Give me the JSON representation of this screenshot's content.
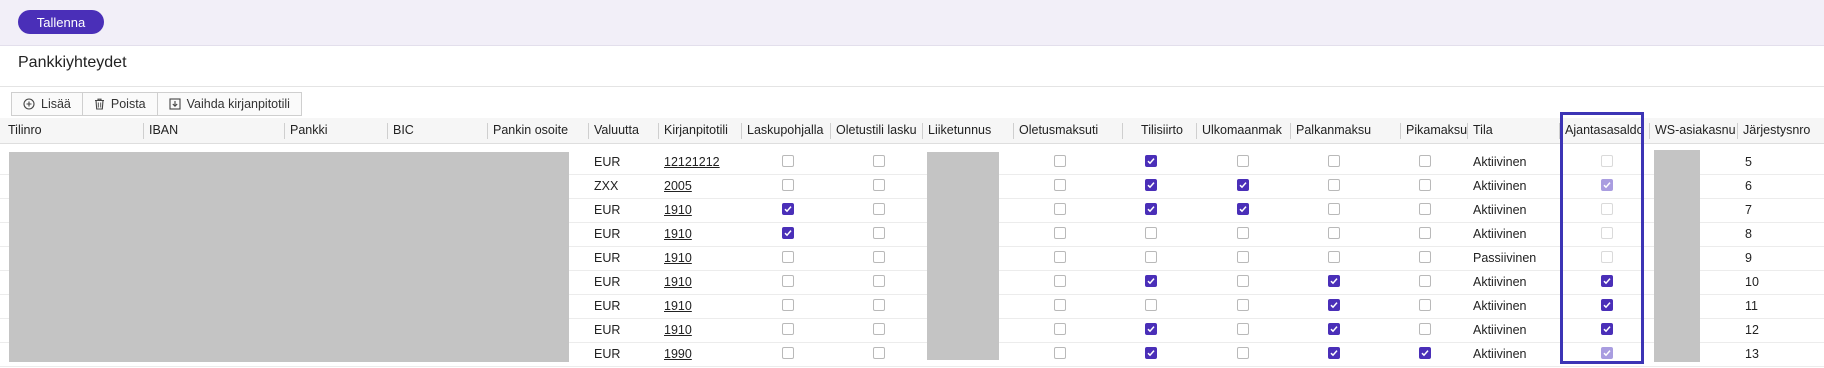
{
  "toolbar_top": {
    "save_label": "Tallenna"
  },
  "page": {
    "title": "Pankkiyhteydet"
  },
  "actions": {
    "add_label": "Lisää",
    "add_icon": "plus-circle-icon",
    "delete_label": "Poista",
    "delete_icon": "trash-icon",
    "switch_label": "Vaihda kirjanpitotili",
    "switch_icon": "download-box-icon"
  },
  "columns": [
    "Tilinro",
    "IBAN",
    "Pankki",
    "BIC",
    "Pankin osoite",
    "Valuutta",
    "Kirjanpitotili",
    "Laskupohjalla",
    "Oletustili lasku",
    "Liiketunnus",
    "Oletusmaksuti",
    "Tilisiirto",
    "Ulkomaanmak",
    "Palkanmaksu",
    "Pikamaksu",
    "Tila",
    "Ajantasasaldo",
    "WS-asiakasnu",
    "Järjestysnro"
  ],
  "rows": [
    {
      "valuutta": "EUR",
      "kirjanpitotili": "12121212",
      "laskupohjalla": false,
      "oletustili": false,
      "oletusmaksu": false,
      "tilisiirto": true,
      "ulkomaan": false,
      "palkanmaksu": false,
      "pikamaksu": false,
      "tila": "Aktiivinen",
      "ajantasasaldo": false,
      "ajantasasaldo_enabled": false,
      "nro": "5"
    },
    {
      "valuutta": "ZXX",
      "kirjanpitotili": "2005",
      "laskupohjalla": false,
      "oletustili": false,
      "oletusmaksu": false,
      "tilisiirto": true,
      "ulkomaan": true,
      "palkanmaksu": false,
      "pikamaksu": false,
      "tila": "Aktiivinen",
      "ajantasasaldo": true,
      "ajantasasaldo_enabled": false,
      "nro": "6"
    },
    {
      "valuutta": "EUR",
      "kirjanpitotili": "1910",
      "laskupohjalla": true,
      "oletustili": false,
      "oletusmaksu": false,
      "tilisiirto": true,
      "ulkomaan": true,
      "palkanmaksu": false,
      "pikamaksu": false,
      "tila": "Aktiivinen",
      "ajantasasaldo": false,
      "ajantasasaldo_enabled": false,
      "nro": "7"
    },
    {
      "valuutta": "EUR",
      "kirjanpitotili": "1910",
      "laskupohjalla": true,
      "oletustili": false,
      "oletusmaksu": false,
      "tilisiirto": false,
      "ulkomaan": false,
      "palkanmaksu": false,
      "pikamaksu": false,
      "tila": "Aktiivinen",
      "ajantasasaldo": false,
      "ajantasasaldo_enabled": false,
      "nro": "8"
    },
    {
      "valuutta": "EUR",
      "kirjanpitotili": "1910",
      "laskupohjalla": false,
      "oletustili": false,
      "oletusmaksu": false,
      "tilisiirto": false,
      "ulkomaan": false,
      "palkanmaksu": false,
      "pikamaksu": false,
      "tila": "Passiivinen",
      "ajantasasaldo": false,
      "ajantasasaldo_enabled": false,
      "nro": "9"
    },
    {
      "valuutta": "EUR",
      "kirjanpitotili": "1910",
      "laskupohjalla": false,
      "oletustili": false,
      "oletusmaksu": false,
      "tilisiirto": true,
      "ulkomaan": false,
      "palkanmaksu": true,
      "pikamaksu": false,
      "tila": "Aktiivinen",
      "ajantasasaldo": true,
      "ajantasasaldo_enabled": true,
      "nro": "10"
    },
    {
      "valuutta": "EUR",
      "kirjanpitotili": "1910",
      "laskupohjalla": false,
      "oletustili": false,
      "oletusmaksu": false,
      "tilisiirto": false,
      "ulkomaan": false,
      "palkanmaksu": true,
      "pikamaksu": false,
      "tila": "Aktiivinen",
      "ajantasasaldo": true,
      "ajantasasaldo_enabled": true,
      "nro": "11"
    },
    {
      "valuutta": "EUR",
      "kirjanpitotili": "1910",
      "laskupohjalla": false,
      "oletustili": false,
      "oletusmaksu": false,
      "tilisiirto": true,
      "ulkomaan": false,
      "palkanmaksu": true,
      "pikamaksu": false,
      "tila": "Aktiivinen",
      "ajantasasaldo": true,
      "ajantasasaldo_enabled": true,
      "nro": "12"
    },
    {
      "valuutta": "EUR",
      "kirjanpitotili": "1990",
      "laskupohjalla": false,
      "oletustili": false,
      "oletusmaksu": false,
      "tilisiirto": true,
      "ulkomaan": false,
      "palkanmaksu": true,
      "pikamaksu": true,
      "tila": "Aktiivinen",
      "ajantasasaldo": true,
      "ajantasasaldo_enabled": false,
      "nro": "13"
    }
  ],
  "colors": {
    "accent": "#4a2fb8",
    "highlight_border": "#3c34b5",
    "redaction": "#c4c4c4"
  }
}
